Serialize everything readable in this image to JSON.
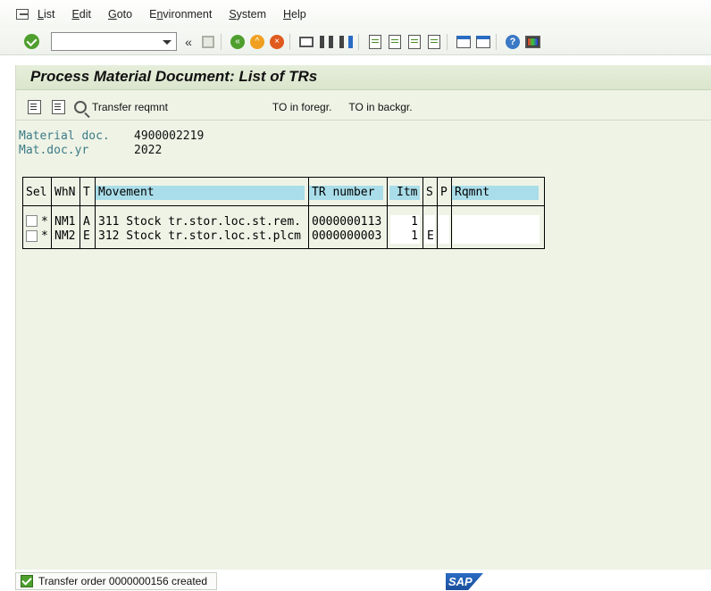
{
  "menu": {
    "items": [
      "List",
      "Edit",
      "Goto",
      "Environment",
      "System",
      "Help"
    ],
    "underline": [
      "L",
      "E",
      "G",
      "n",
      "S",
      "H"
    ]
  },
  "toolbar": {
    "command_field_value": "",
    "back_glyph": "«"
  },
  "page": {
    "title": "Process Material Document: List of TRs"
  },
  "app_toolbar": {
    "transfer_reqmnt_label": "Transfer reqmnt",
    "to_foreground_label": "TO in foregr.",
    "to_background_label": "TO in backgr."
  },
  "fields": {
    "material_doc_label": "Material doc.",
    "material_doc_value": "4900002219",
    "mat_doc_yr_label": "Mat.doc.yr",
    "mat_doc_yr_value": "2022"
  },
  "table": {
    "headers": {
      "sel": "Sel",
      "whn": "WhN",
      "t": "T",
      "movement": "Movement",
      "tr_number": "TR number",
      "itm": "Itm",
      "s": "S",
      "p": "P",
      "rqmnt": "Rqmnt"
    },
    "rows": [
      {
        "selected": false,
        "star": "*",
        "whn": "NM1",
        "t": "A",
        "movement": "311 Stock tr.stor.loc.st.rem.",
        "tr_number": "0000000113",
        "itm": "1",
        "s": "",
        "p": "",
        "rqmnt": ""
      },
      {
        "selected": false,
        "star": "*",
        "whn": "NM2",
        "t": "E",
        "movement": "312 Stock tr.stor.loc.st.plcm",
        "tr_number": "0000000003",
        "itm": "1",
        "s": "E",
        "p": "",
        "rqmnt": ""
      }
    ]
  },
  "status": {
    "message": "Transfer order 0000000156 created",
    "logo": "SAP"
  }
}
